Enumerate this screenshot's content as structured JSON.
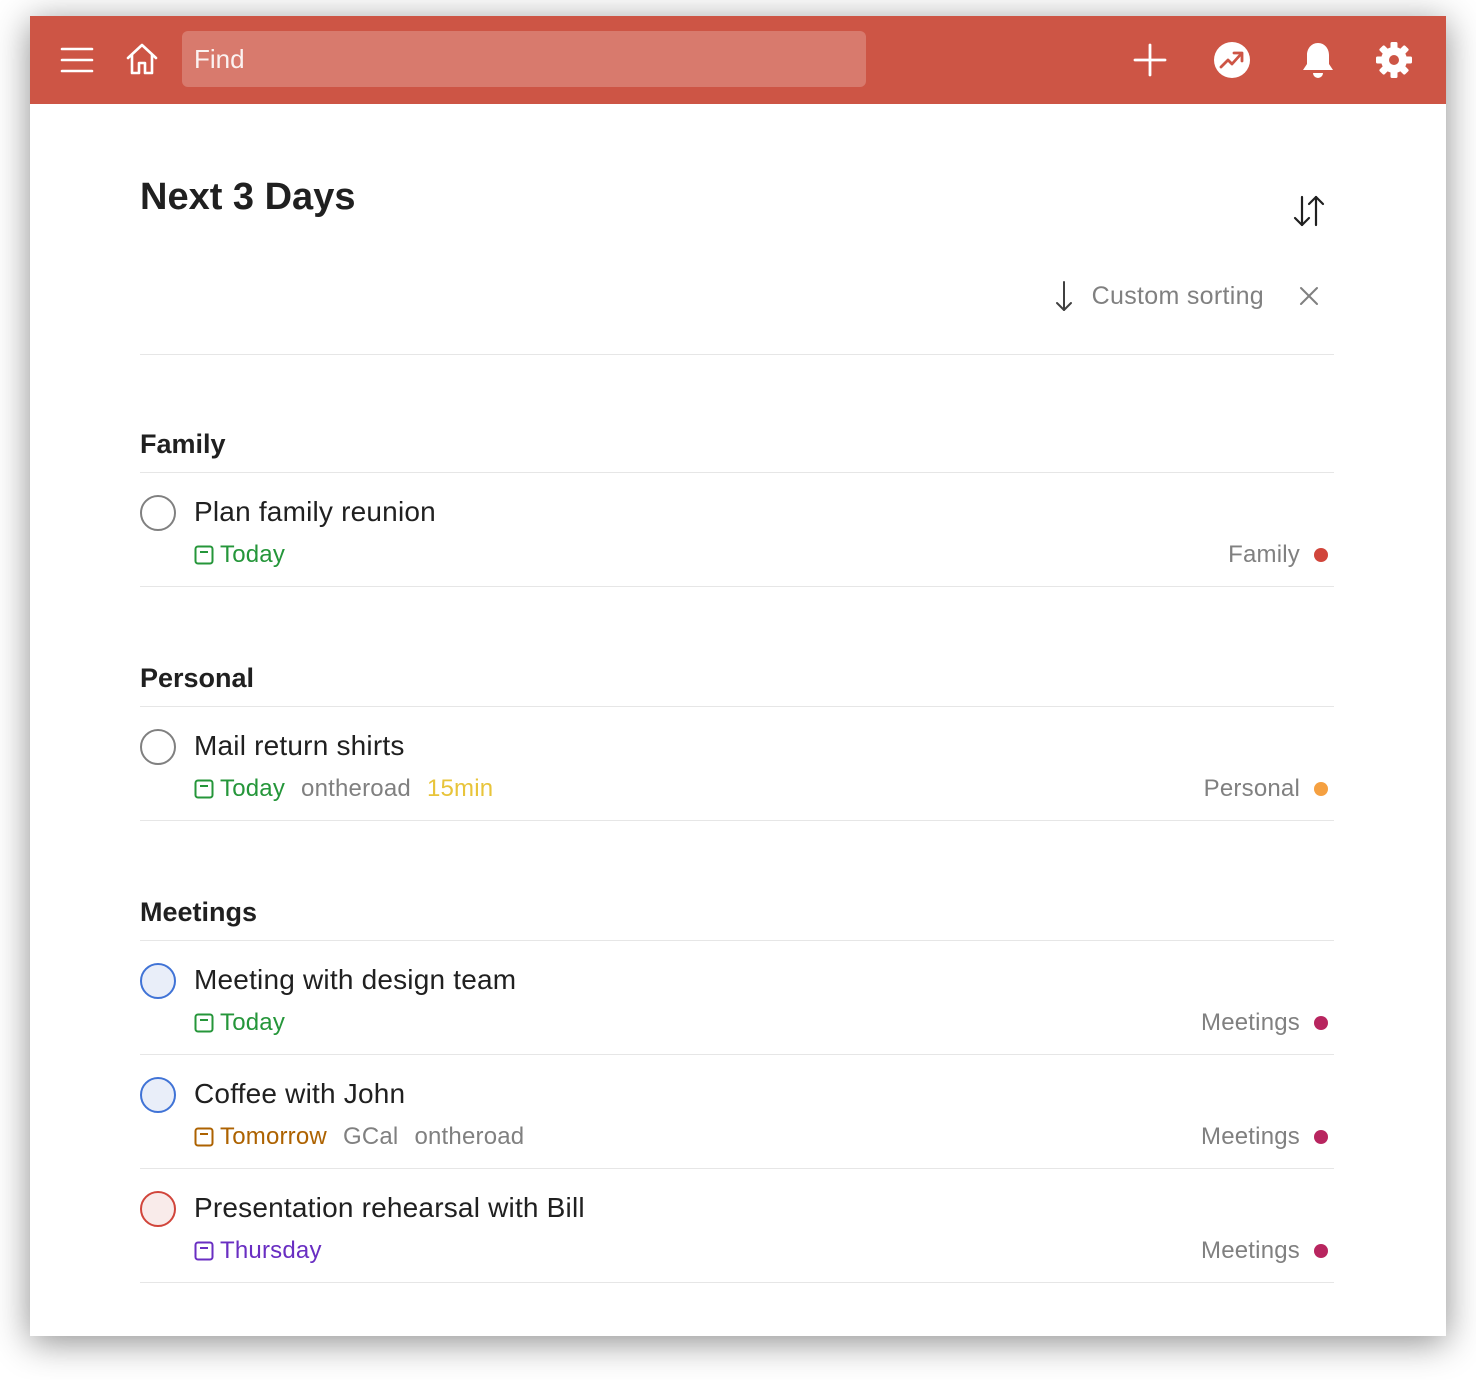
{
  "topbar": {
    "search_placeholder": "Find",
    "icons": [
      "menu-icon",
      "home-icon",
      "plus-icon",
      "productivity-icon",
      "bell-icon",
      "gear-icon"
    ],
    "color": "#cd5545"
  },
  "page": {
    "title": "Next 3 Days",
    "sort_label": "Custom sorting"
  },
  "colors": {
    "today": "#25963a",
    "tomorrow": "#ad6200",
    "thursday": "#692ec2",
    "project_family": "#d1453b",
    "project_personal": "#f5a041",
    "project_meetings": "#b8255f",
    "duration": "#e8c43a"
  },
  "sections": [
    {
      "title": "Family",
      "tasks": [
        {
          "title": "Plan family reunion",
          "due": "Today",
          "labels": [],
          "duration": "",
          "project": "Family",
          "priority": "none"
        }
      ]
    },
    {
      "title": "Personal",
      "tasks": [
        {
          "title": "Mail return shirts",
          "due": "Today",
          "labels": [
            "ontheroad"
          ],
          "duration": "15min",
          "project": "Personal",
          "priority": "none"
        }
      ]
    },
    {
      "title": "Meetings",
      "tasks": [
        {
          "title": "Meeting with design team",
          "due": "Today",
          "labels": [],
          "duration": "",
          "project": "Meetings",
          "priority": "blue"
        },
        {
          "title": "Coffee with John",
          "due": "Tomorrow",
          "labels": [
            "GCal",
            "ontheroad"
          ],
          "duration": "",
          "project": "Meetings",
          "priority": "blue"
        },
        {
          "title": "Presentation rehearsal with Bill",
          "due": "Thursday",
          "labels": [],
          "duration": "",
          "project": "Meetings",
          "priority": "red"
        }
      ]
    }
  ]
}
